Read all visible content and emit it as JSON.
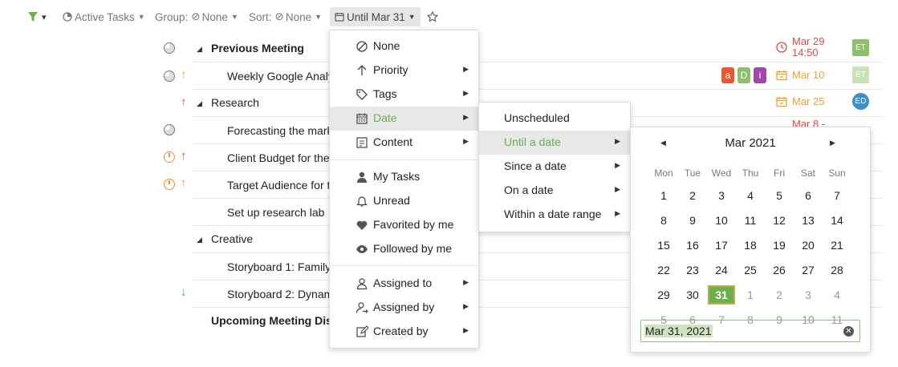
{
  "toolbar": {
    "filter_caret": "▾",
    "active_tasks": "Active Tasks",
    "group_label": "Group:",
    "group_value": "None",
    "sort_label": "Sort:",
    "sort_value": "None",
    "until_label": "Until Mar 31"
  },
  "tasks": [
    {
      "title": "Previous Meeting",
      "due": "Mar 29",
      "due2": "14:50",
      "avatar": "ET"
    },
    {
      "title": "Weekly Google Analy",
      "tags": [
        "a",
        "D",
        "i"
      ],
      "due": "Mar 10",
      "avatar": "ET"
    },
    {
      "title": "Research",
      "due": "Mar 25",
      "avatar": "ED"
    },
    {
      "title": "Forecasting the mark",
      "due": "Mar 8 -"
    },
    {
      "title": "Client Budget for the"
    },
    {
      "title": "Target Audience for t"
    },
    {
      "title": "Set up research lab"
    },
    {
      "title": "Creative"
    },
    {
      "title": "Storyboard 1: Family"
    },
    {
      "title": "Storyboard 2: Dynam"
    },
    {
      "title": "Upcoming Meeting Disc"
    }
  ],
  "filter_menu": {
    "items": [
      "None",
      "Priority",
      "Tags",
      "Date",
      "Content",
      "My Tasks",
      "Unread",
      "Favorited by me",
      "Followed by me",
      "Assigned to",
      "Assigned by",
      "Created by"
    ]
  },
  "date_menu": {
    "items": [
      "Unscheduled",
      "Until a date",
      "Since a date",
      "On a date",
      "Within a date range"
    ]
  },
  "calendar": {
    "month": "Mar 2021",
    "weekdays": [
      "Mon",
      "Tue",
      "Wed",
      "Thu",
      "Fri",
      "Sat",
      "Sun"
    ],
    "weeks": [
      [
        "1",
        "2",
        "3",
        "4",
        "5",
        "6",
        "7"
      ],
      [
        "8",
        "9",
        "10",
        "11",
        "12",
        "13",
        "14"
      ],
      [
        "15",
        "16",
        "17",
        "18",
        "19",
        "20",
        "21"
      ],
      [
        "22",
        "23",
        "24",
        "25",
        "26",
        "27",
        "28"
      ],
      [
        "29",
        "30",
        "31",
        "1",
        "2",
        "3",
        "4"
      ],
      [
        "5",
        "6",
        "7",
        "8",
        "9",
        "10",
        "11"
      ]
    ],
    "selected": "31",
    "input_value": "Mar 31, 2021"
  },
  "colors": {
    "accent_green": "#6ab04c",
    "due_red": "#e04848",
    "due_orange": "#f0a030",
    "avatar_green": "#8cc06a",
    "avatar_blue": "#3b8fd0"
  }
}
